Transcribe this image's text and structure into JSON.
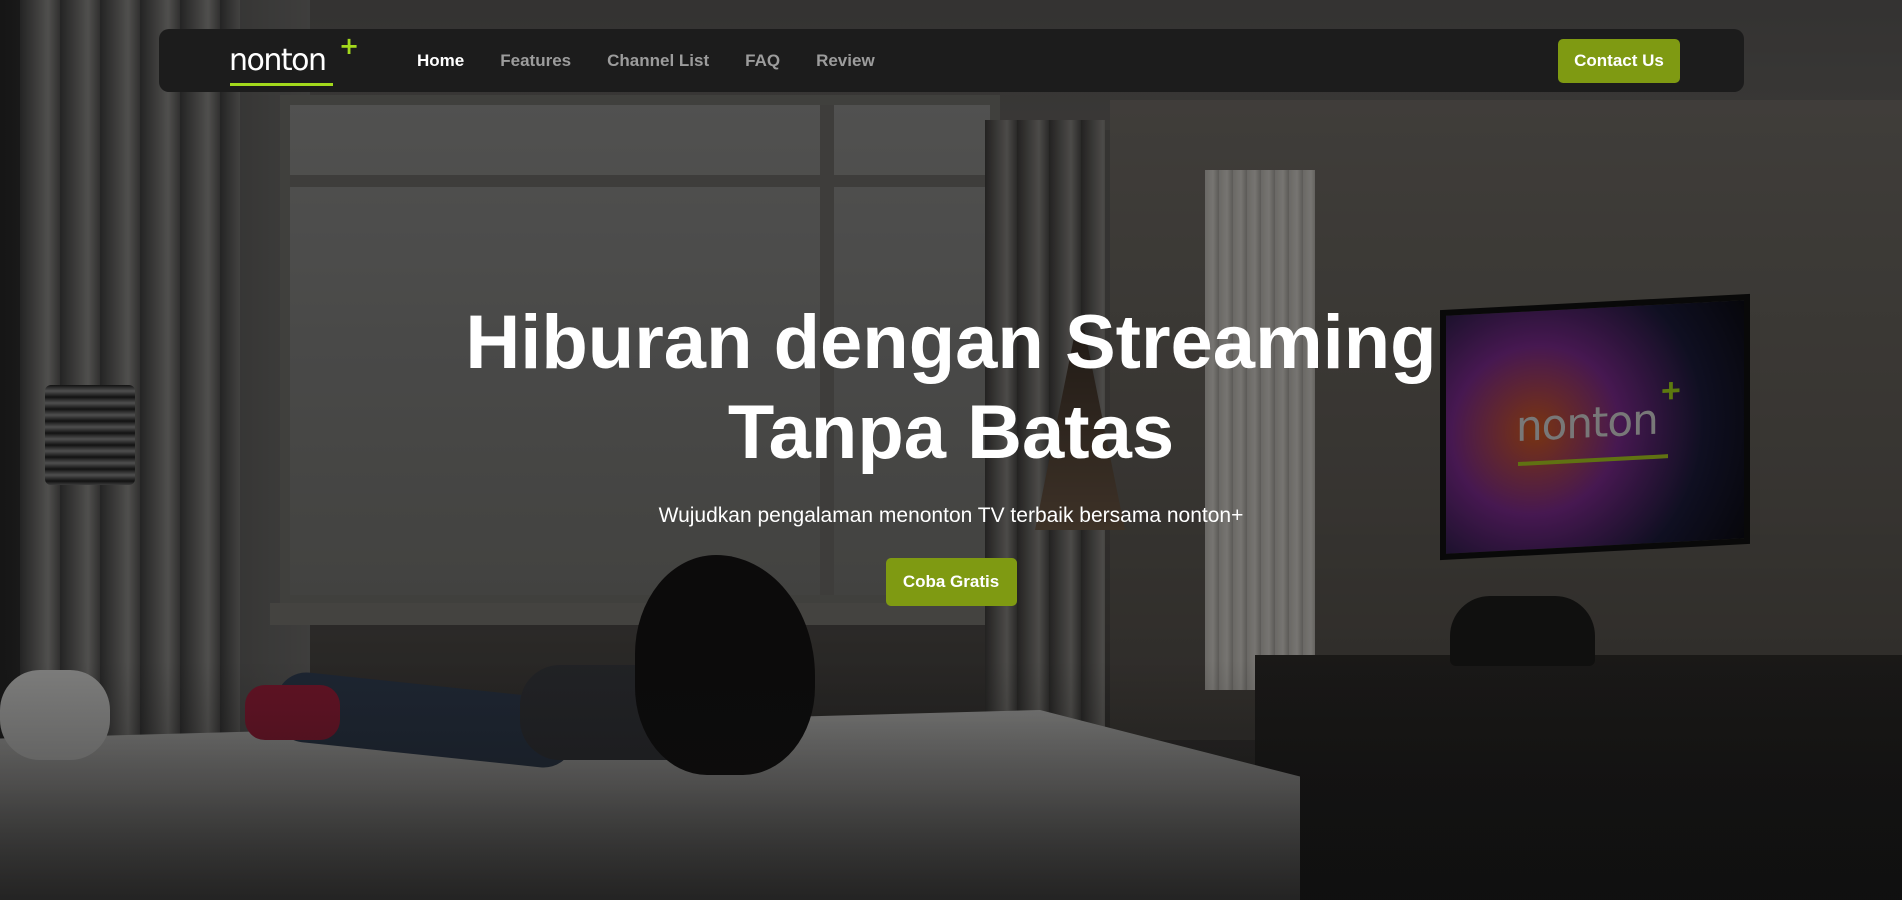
{
  "brand": {
    "logo_text": "nonton",
    "logo_plus": "+",
    "accent_color": "#7f9a12",
    "logo_accent_color": "#a3d91c"
  },
  "nav": {
    "items": [
      {
        "label": "Home",
        "active": true
      },
      {
        "label": "Features",
        "active": false
      },
      {
        "label": "Channel List",
        "active": false
      },
      {
        "label": "FAQ",
        "active": false
      },
      {
        "label": "Review",
        "active": false
      }
    ],
    "contact_label": "Contact Us"
  },
  "hero": {
    "title": "Hiburan dengan Streaming Tanpa Batas",
    "subtitle": "Wujudkan pengalaman menonton TV terbaik bersama nonton+",
    "cta_label": "Coba Gratis"
  },
  "background": {
    "tv_screen_logo_text": "nonton",
    "tv_screen_logo_plus": "+"
  }
}
